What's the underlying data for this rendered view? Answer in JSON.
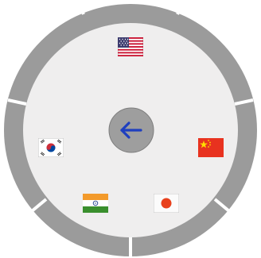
{
  "radial_menu": {
    "colors": {
      "ring": "#9b9b9b",
      "ring_separator": "#ffffff",
      "inner_disc": "#efeeee",
      "center_button": "#9e9e9e",
      "arrow": "#1f3fbf"
    },
    "center_button": {
      "icon": "arrow-left-icon"
    },
    "items": [
      {
        "id": "us",
        "icon": "us-flag-icon"
      },
      {
        "id": "cn",
        "icon": "china-flag-icon"
      },
      {
        "id": "jp",
        "icon": "japan-flag-icon"
      },
      {
        "id": "in",
        "icon": "india-flag-icon"
      },
      {
        "id": "kr",
        "icon": "south-korea-flag-icon"
      }
    ]
  }
}
